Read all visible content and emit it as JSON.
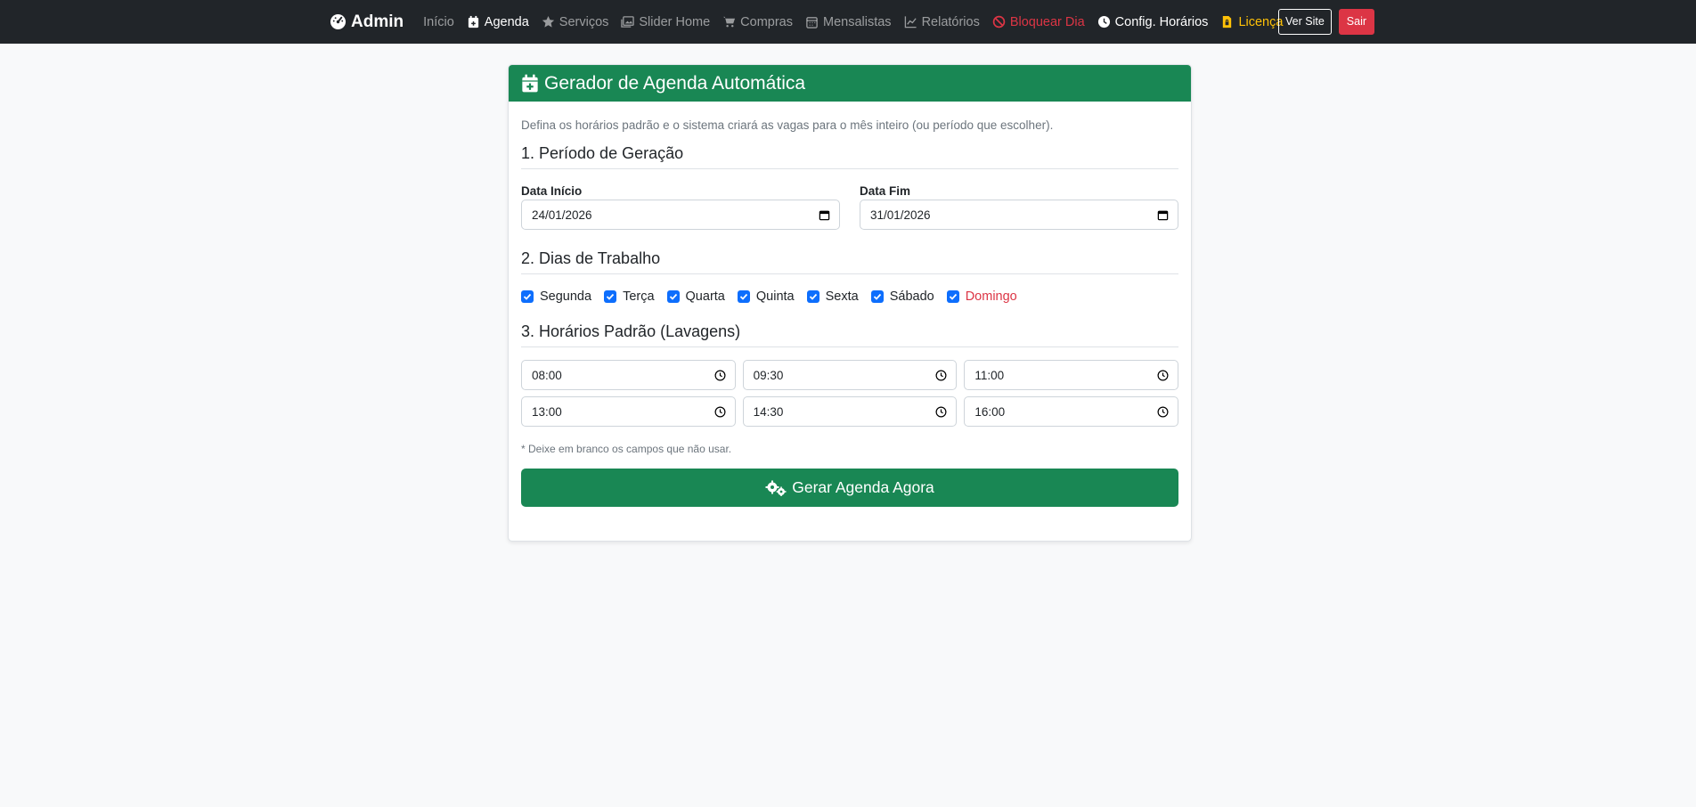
{
  "navbar": {
    "brand": "Admin",
    "links": {
      "inicio": "Início",
      "agenda": "Agenda",
      "servicos": "Serviços",
      "slider": "Slider Home",
      "compras": "Compras",
      "mensalistas": "Mensalistas",
      "relatorios": "Relatórios",
      "bloquear": "Bloquear Dia",
      "config": "Config. Horários",
      "licenca": "Licença"
    },
    "ver_site": "Ver Site",
    "sair": "Sair"
  },
  "card": {
    "title": "Gerador de Agenda Automática",
    "intro": "Defina os horários padrão e o sistema criará as vagas para o mês inteiro (ou período que escolher).",
    "section1": "1. Período de Geração",
    "data_inicio_label": "Data Início",
    "data_inicio_value": "24/01/2026",
    "data_fim_label": "Data Fim",
    "data_fim_value": "31/01/2026",
    "section2": "2. Dias de Trabalho",
    "days": [
      "Segunda",
      "Terça",
      "Quarta",
      "Quinta",
      "Sexta",
      "Sábado",
      "Domingo"
    ],
    "section3": "3. Horários Padrão (Lavagens)",
    "times": [
      "08:00",
      "09:30",
      "11:00",
      "13:00",
      "14:30",
      "16:00"
    ],
    "note": "* Deixe em branco os campos que não usar.",
    "button": "Gerar Agenda Agora"
  },
  "colors": {
    "navbar": "#212529",
    "success": "#198754",
    "danger": "#dc3545",
    "warning": "#ffc107",
    "primary": "#0d6efd"
  }
}
